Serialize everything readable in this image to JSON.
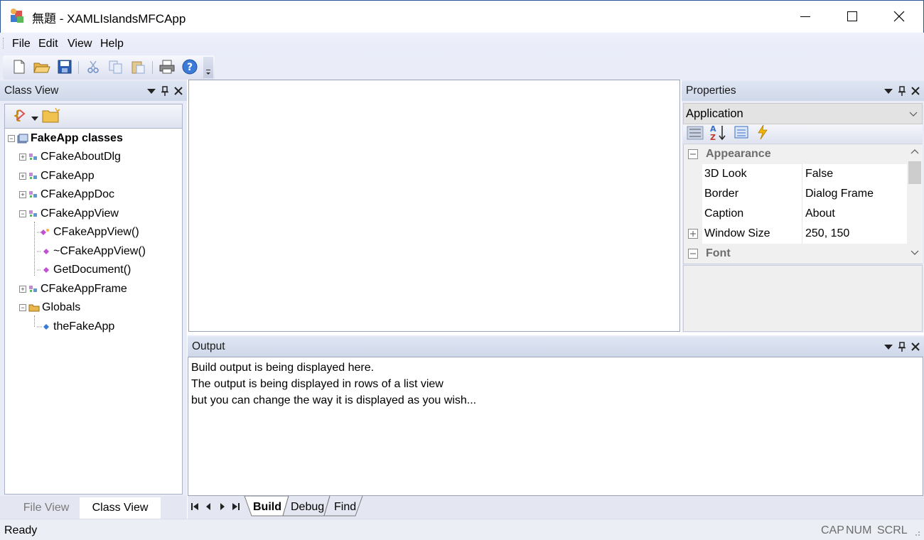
{
  "window": {
    "title": "無題 - XAMLIslandsMFCApp"
  },
  "menu": [
    "File",
    "Edit",
    "View",
    "Help"
  ],
  "class_view": {
    "title": "Class View",
    "tree": [
      {
        "label": "FakeApp classes",
        "bold": true
      },
      {
        "label": "CFakeAboutDlg"
      },
      {
        "label": "CFakeApp"
      },
      {
        "label": "CFakeAppDoc"
      },
      {
        "label": "CFakeAppView"
      },
      {
        "label": "CFakeAppView()"
      },
      {
        "label": "~CFakeAppView()"
      },
      {
        "label": "GetDocument()"
      },
      {
        "label": "CFakeAppFrame"
      },
      {
        "label": "Globals"
      },
      {
        "label": "theFakeApp"
      }
    ],
    "tabs": [
      "File View",
      "Class View"
    ]
  },
  "properties": {
    "title": "Properties",
    "combo": "Application",
    "rows": [
      {
        "category": "Appearance"
      },
      {
        "name": "3D Look",
        "value": "False"
      },
      {
        "name": "Border",
        "value": "Dialog Frame"
      },
      {
        "name": "Caption",
        "value": "About"
      },
      {
        "name": "Window Size",
        "value": "250, 150"
      },
      {
        "category": "Font"
      }
    ]
  },
  "output": {
    "title": "Output",
    "lines": [
      "Build output is being displayed here.",
      "The output is being displayed in rows of a list view",
      "but you can change the way it is displayed as you wish..."
    ],
    "tabs": [
      "Build",
      "Debug",
      "Find"
    ]
  },
  "status": {
    "text": "Ready",
    "indicators": [
      "CAP",
      "NUM",
      "SCRL"
    ]
  },
  "colors": {
    "panel_header": "#d4dcee",
    "title_border": "#2b5797"
  }
}
